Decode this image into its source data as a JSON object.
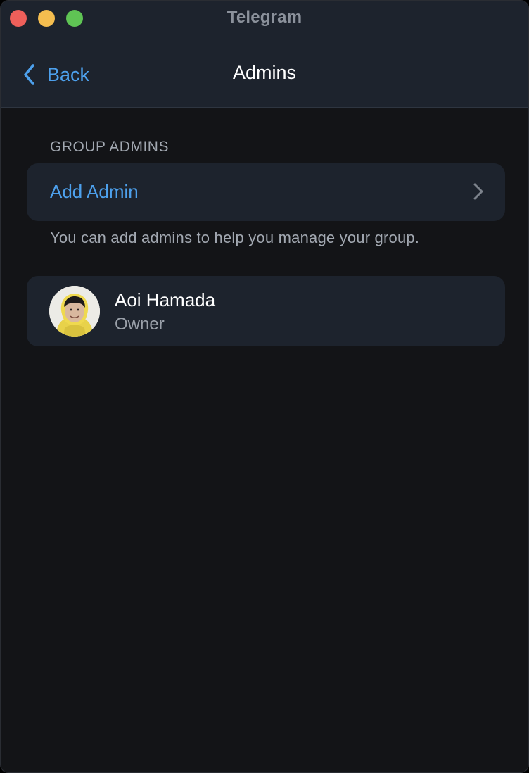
{
  "window": {
    "title": "Telegram"
  },
  "navbar": {
    "back_label": "Back",
    "title": "Admins"
  },
  "group_admins": {
    "header": "GROUP ADMINS",
    "add_admin_label": "Add Admin",
    "footer": "You can add admins to help you manage your group.",
    "admins": [
      {
        "name": "Aoi Hamada",
        "role": "Owner"
      }
    ]
  },
  "colors": {
    "accent": "#4da0ec",
    "background": "#131417",
    "card": "#1d232d",
    "close": "#ee5f5a",
    "minimize": "#f4bd4f",
    "maximize": "#5fc454"
  }
}
